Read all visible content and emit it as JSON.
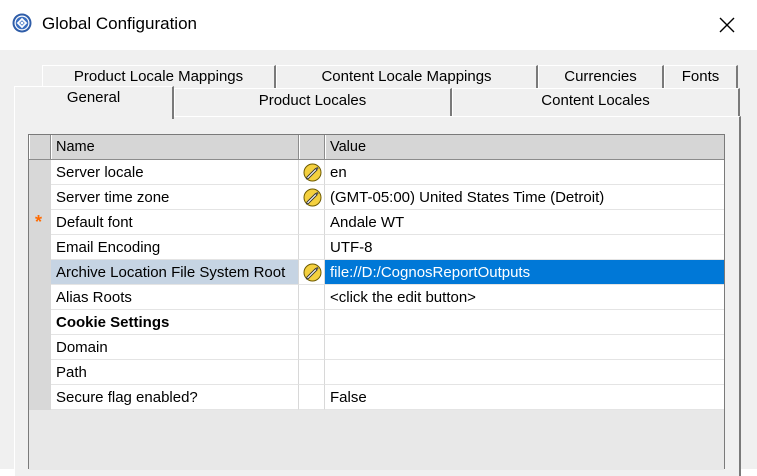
{
  "window": {
    "title": "Global Configuration",
    "icon": "cognos-app-icon",
    "close_icon": "close-icon"
  },
  "tabs": {
    "row1": [
      {
        "label": "Product Locale Mappings"
      },
      {
        "label": "Content Locale Mappings"
      },
      {
        "label": "Currencies"
      },
      {
        "label": "Fonts"
      }
    ],
    "row2": [
      {
        "label": "General",
        "selected": true
      },
      {
        "label": "Product Locales"
      },
      {
        "label": "Content Locales"
      }
    ]
  },
  "grid": {
    "columns": {
      "name": "Name",
      "value": "Value"
    },
    "rows": [
      {
        "name": "Server locale",
        "value": "en",
        "has_edit_icon": true
      },
      {
        "name": "Server time zone",
        "value": "(GMT-05:00) United States Time (Detroit)",
        "has_edit_icon": true
      },
      {
        "name": "Default font",
        "value": "Andale WT",
        "required": true,
        "required_mark": "*"
      },
      {
        "name": "Email Encoding",
        "value": "UTF-8"
      },
      {
        "name": "Archive Location File System Root",
        "value": "file://D:/CognosReportOutputs",
        "has_edit_icon": true,
        "selected": true
      },
      {
        "name": "Alias Roots",
        "value": "<click the edit button>"
      },
      {
        "name": "Cookie Settings",
        "value": "",
        "group_header": true
      },
      {
        "name": "Domain",
        "value": ""
      },
      {
        "name": "Path",
        "value": ""
      },
      {
        "name": "Secure flag enabled?",
        "value": "False"
      }
    ]
  },
  "colors": {
    "selection": "#0078d7",
    "required_marker": "#ff6a00",
    "edit_icon": "#f4d03f"
  }
}
